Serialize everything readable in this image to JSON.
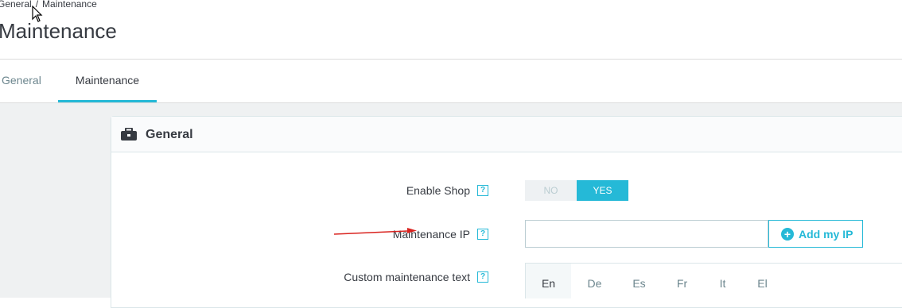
{
  "breadcrumb": {
    "parent": "General",
    "separator": "/",
    "current": "Maintenance"
  },
  "page_title": "Maintenance",
  "tabs": [
    {
      "label": "General",
      "active": false
    },
    {
      "label": "Maintenance",
      "active": true
    }
  ],
  "panel": {
    "title": "General",
    "icon": "toolbox-icon",
    "fields": {
      "enable_shop": {
        "label": "Enable Shop",
        "help": "?",
        "no": "NO",
        "yes": "YES",
        "selected": "YES"
      },
      "maintenance_ip": {
        "label": "Maintenance IP",
        "help": "?",
        "value": "",
        "button": "Add my IP"
      },
      "custom_text": {
        "label": "Custom maintenance text",
        "help": "?"
      }
    },
    "languages": [
      "En",
      "De",
      "Es",
      "Fr",
      "It",
      "El"
    ],
    "active_language": "En"
  },
  "colors": {
    "accent": "#25b9d7",
    "text": "#363a41",
    "muted": "#6c868e",
    "background": "#eff1f2",
    "annotation_arrow": "#d9231f"
  }
}
